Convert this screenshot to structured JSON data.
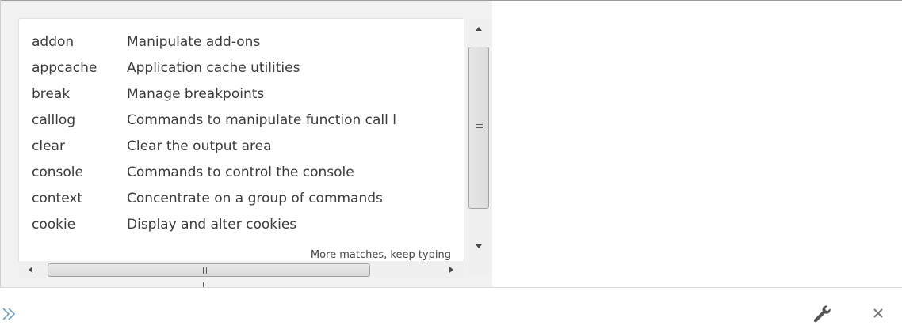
{
  "autocomplete": {
    "items": [
      {
        "command": "addon",
        "description": "Manipulate add-ons"
      },
      {
        "command": "appcache",
        "description": "Application cache utilities"
      },
      {
        "command": "break",
        "description": "Manage breakpoints"
      },
      {
        "command": "calllog",
        "description": "Commands to manipulate function call l"
      },
      {
        "command": "clear",
        "description": "Clear the output area"
      },
      {
        "command": "console",
        "description": "Commands to control the console"
      },
      {
        "command": "context",
        "description": "Concentrate on a group of commands"
      },
      {
        "command": "cookie",
        "description": "Display and alter cookies"
      }
    ],
    "more_text": "More matches, keep typing"
  },
  "commandline": {
    "prompt_icon": "double-chevron-right-icon",
    "input_value": "",
    "input_placeholder": ""
  },
  "toolbar": {
    "options_icon": "wrench-icon",
    "close_icon": "close-icon"
  },
  "colors": {
    "prompt": "#6d9ec4",
    "text": "#3b3b3b",
    "icon": "#555555"
  }
}
